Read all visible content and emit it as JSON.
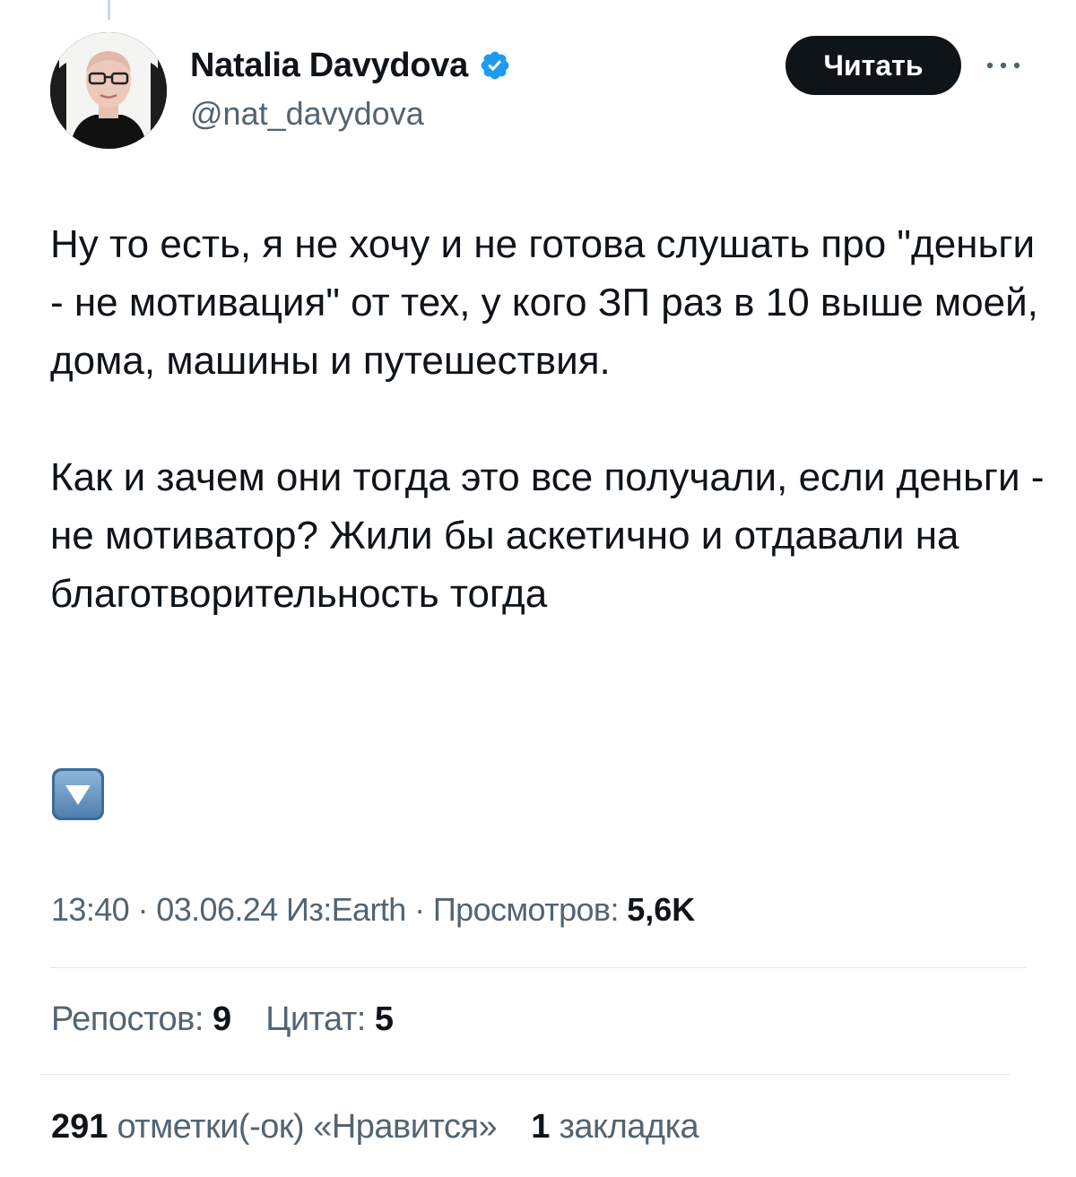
{
  "author": {
    "display_name": "Natalia Davydova",
    "handle": "@nat_davydova",
    "verified": true
  },
  "actions": {
    "follow_label": "Читать",
    "more_icon": "more-horizontal-icon"
  },
  "tweet": {
    "paragraph_1": "Ну то есть, я не хочу и не готова слушать про \"деньги - не мотивация\" от тех, у кого ЗП раз в 10 выше моей, дома, машины и путешествия.",
    "paragraph_2": "Как и зачем они тогда это все получали, если деньги - не мотиватор? Жили бы аскетично и отдавали на благотворительность тогда",
    "emoji": "down-arrow-button-emoji"
  },
  "meta": {
    "time": "13:40",
    "date": "03.06.24",
    "source": "Из:Earth",
    "views_label": "Просмотров:",
    "views_value": "5,6K",
    "separator": "·"
  },
  "stats": {
    "reposts_label": "Репостов:",
    "reposts_value": "9",
    "quotes_label": "Цитат:",
    "quotes_value": "5",
    "likes_value": "291",
    "likes_label": "отметки(-ок) «Нравится»",
    "bookmarks_value": "1",
    "bookmarks_label": "закладка"
  },
  "colors": {
    "text_primary": "#0f1419",
    "text_secondary": "#536471",
    "verified_blue": "#1d9bf0",
    "divider": "#e3e8eb",
    "button_bg": "#0f1419"
  }
}
